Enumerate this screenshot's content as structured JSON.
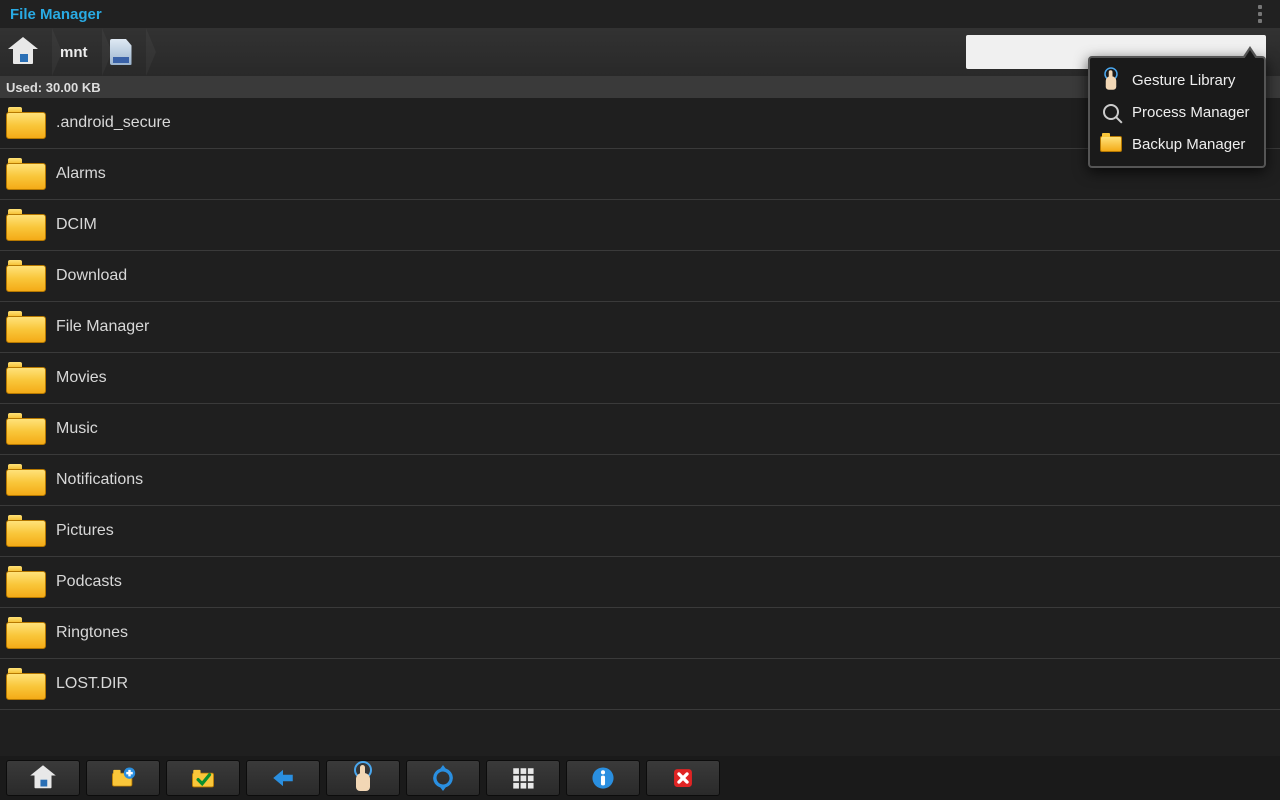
{
  "title": "File Manager",
  "breadcrumb": {
    "segment1": "mnt"
  },
  "status": {
    "used_label": "Used: 30.00 KB"
  },
  "search": {
    "placeholder": ""
  },
  "folders": [
    {
      "name": ".android_secure"
    },
    {
      "name": "Alarms"
    },
    {
      "name": "DCIM"
    },
    {
      "name": "Download"
    },
    {
      "name": "File Manager"
    },
    {
      "name": "Movies"
    },
    {
      "name": "Music"
    },
    {
      "name": "Notifications"
    },
    {
      "name": "Pictures"
    },
    {
      "name": "Podcasts"
    },
    {
      "name": "Ringtones"
    },
    {
      "name": "LOST.DIR"
    }
  ],
  "popup": {
    "item1": "Gesture Library",
    "item2": "Process Manager",
    "item3": "Backup Manager"
  },
  "toolbar": {
    "home": "Home",
    "newfolder": "New Folder",
    "select": "Select",
    "back": "Back",
    "gesture": "Gesture",
    "refresh": "Refresh",
    "grid": "Grid",
    "info": "Info",
    "close": "Close"
  }
}
